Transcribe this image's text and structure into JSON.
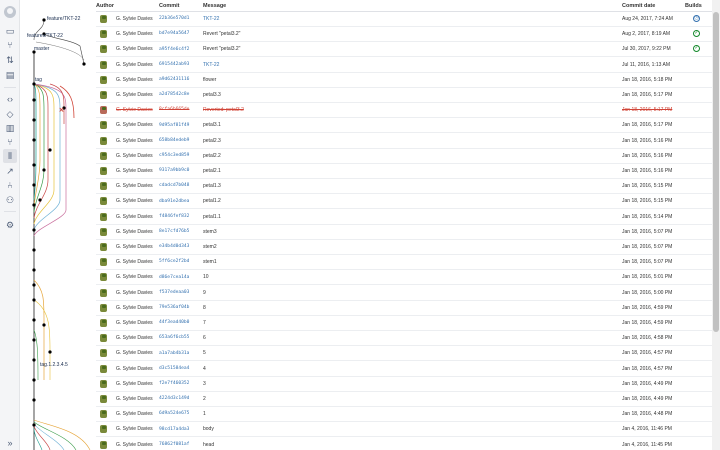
{
  "nav": {
    "icons": [
      "avatar-icon",
      "source-icon",
      "branches-icon",
      "pull-requests-icon",
      "insights-icon",
      "code-icon",
      "commits-icon",
      "reports-icon",
      "pipelines-icon",
      "branch-graph-icon",
      "deployments-icon",
      "forks-icon",
      "integrations-icon",
      "settings-icon",
      "expand-icon"
    ],
    "expand_glyph": "»"
  },
  "graph": {
    "refs": [
      {
        "label": "feature/TKT-22"
      },
      {
        "label": "features/TKT-22"
      },
      {
        "label": "master"
      },
      {
        "label": "tag"
      },
      {
        "label": "tag.1.2.3.4.5"
      }
    ]
  },
  "table": {
    "headers": {
      "author": "Author",
      "commit": "Commit",
      "message": "Message",
      "date": "Commit date",
      "builds": "Builds"
    },
    "rows": [
      {
        "author": "G. Sylvie Davies",
        "commit": "22b36e570d1",
        "message": "TKT-22",
        "message_link": true,
        "date": "Aug 24, 2017, 7:24 AM",
        "build": "inprogress"
      },
      {
        "author": "G. Sylvie Davies",
        "commit": "bd7e94a5647",
        "message": "Revert \"petal3.2\"",
        "date": "Aug 2, 2017, 8:19 AM",
        "build": "success"
      },
      {
        "author": "G. Sylvie Davies",
        "commit": "a95f4e6c4f2",
        "message": "Revert \"petal3.2\"",
        "date": "Jul 30, 2017, 9:22 PM",
        "build": "success"
      },
      {
        "author": "G. Sylvie Davies",
        "commit": "6915442ab93",
        "message": "TKT-22",
        "message_link": true,
        "date": "Jul 11, 2016, 1:13 AM"
      },
      {
        "author": "G. Sylvie Davies",
        "commit": "a9d62431116",
        "message": "flower",
        "date": "Jan 18, 2016, 5:18 PM"
      },
      {
        "author": "G. Sylvie Davies",
        "commit": "a2d78542c8e",
        "message": "petal3.3",
        "date": "Jan 18, 2016, 5:17 PM"
      },
      {
        "author": "G. Sylvie Davies",
        "commit": "8cfa6b665de",
        "message": "Reverted: petal3.2",
        "date": "Jan 18, 2016, 5:17 PM",
        "reverted": true
      },
      {
        "author": "G. Sylvie Davies",
        "commit": "9d95af81f49",
        "message": "petal3.1",
        "date": "Jan 18, 2016, 5:17 PM"
      },
      {
        "author": "G. Sylvie Davies",
        "commit": "658b84edeb9",
        "message": "petal2.3",
        "date": "Jan 18, 2016, 5:16 PM"
      },
      {
        "author": "G. Sylvie Davies",
        "commit": "c954c3ed859",
        "message": "petal2.2",
        "date": "Jan 18, 2016, 5:16 PM"
      },
      {
        "author": "G. Sylvie Davies",
        "commit": "9317a9bb9c0",
        "message": "petal2.1",
        "date": "Jan 18, 2016, 5:16 PM"
      },
      {
        "author": "G. Sylvie Davies",
        "commit": "cdadcd7b048",
        "message": "petal1.3",
        "date": "Jan 18, 2016, 5:15 PM"
      },
      {
        "author": "G. Sylvie Davies",
        "commit": "dba91e2dbea",
        "message": "petal1.2",
        "date": "Jan 18, 2016, 5:15 PM"
      },
      {
        "author": "G. Sylvie Davies",
        "commit": "f4846fef832",
        "message": "petal1.1",
        "date": "Jan 18, 2016, 5:14 PM"
      },
      {
        "author": "G. Sylvie Davies",
        "commit": "8e17cfd76b5",
        "message": "stem3",
        "date": "Jan 18, 2016, 5:07 PM"
      },
      {
        "author": "G. Sylvie Davies",
        "commit": "e34b4d0d343",
        "message": "stem2",
        "date": "Jan 18, 2016, 5:07 PM"
      },
      {
        "author": "G. Sylvie Davies",
        "commit": "5ff6ce2f2bd",
        "message": "stem1",
        "date": "Jan 18, 2016, 5:07 PM"
      },
      {
        "author": "G. Sylvie Davies",
        "commit": "d86e7cea14a",
        "message": "10",
        "date": "Jan 18, 2016, 5:01 PM"
      },
      {
        "author": "G. Sylvie Davies",
        "commit": "f537edeaa03",
        "message": "9",
        "date": "Jan 18, 2016, 5:00 PM"
      },
      {
        "author": "G. Sylvie Davies",
        "commit": "79e536af04b",
        "message": "8",
        "date": "Jan 18, 2016, 4:59 PM"
      },
      {
        "author": "G. Sylvie Davies",
        "commit": "44f3ead40b0",
        "message": "7",
        "date": "Jan 18, 2016, 4:59 PM"
      },
      {
        "author": "G. Sylvie Davies",
        "commit": "653a6f6cb55",
        "message": "6",
        "date": "Jan 18, 2016, 4:58 PM"
      },
      {
        "author": "G. Sylvie Davies",
        "commit": "a1a7ab4b31a",
        "message": "5",
        "date": "Jan 18, 2016, 4:57 PM"
      },
      {
        "author": "G. Sylvie Davies",
        "commit": "d3c51584ea4",
        "message": "4",
        "date": "Jan 18, 2016, 4:57 PM"
      },
      {
        "author": "G. Sylvie Davies",
        "commit": "f2e7f460352",
        "message": "3",
        "date": "Jan 18, 2016, 4:49 PM"
      },
      {
        "author": "G. Sylvie Davies",
        "commit": "4224d3c149d",
        "message": "2",
        "date": "Jan 18, 2016, 4:49 PM"
      },
      {
        "author": "G. Sylvie Davies",
        "commit": "6d9a524e675",
        "message": "1",
        "date": "Jan 18, 2016, 4:48 PM"
      },
      {
        "author": "G. Sylvie Davies",
        "commit": "98cd17a4da3",
        "message": "body",
        "date": "Jan 4, 2016, 11:46 PM"
      },
      {
        "author": "G. Sylvie Davies",
        "commit": "76862f081af",
        "message": "head",
        "date": "Jan 4, 2016, 11:45 PM"
      }
    ]
  },
  "colors": {
    "link": "#3572b0",
    "reverted": "#d04437",
    "success": "#14892c",
    "inprogress": "#3572b0"
  }
}
